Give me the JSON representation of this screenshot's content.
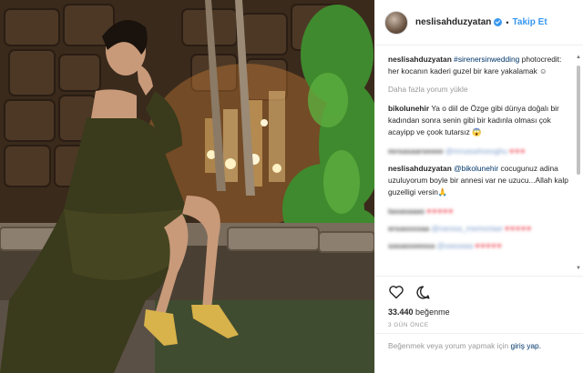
{
  "header": {
    "username": "neslisahduzyatan",
    "separator": "•",
    "follow_label": "Takip Et"
  },
  "caption": {
    "username": "neslisahduzyatan",
    "hashtag": "#sirenersinwedding",
    "text": "photocredit: her kocanın kaderi guzel bir kare yakalamak ☺"
  },
  "load_more_label": "Daha fazla yorum yükle",
  "comments": [
    {
      "username": "bikolunehir",
      "text": "Ya o diil de Özge gibi dünya doğalı bir kadından sonra senin gibi bir kadınla olması çok acayipp ve çook tutarsız 😱"
    },
    {
      "username": "neslisahduzyatan",
      "mention": "@bikolunehir",
      "text": "cocugunuz adina uzuluyorum boyle bir annesi var ne uzucu...Allah kalp guzelligi versin🙏"
    }
  ],
  "blurred_comments": [
    {
      "username": "mrsasaarseeee",
      "mention": "@mrsasahosoghu",
      "hearts": "♥♥♥"
    },
    {
      "username": "tasasaaas",
      "hearts": "♥♥♥♥♥"
    },
    {
      "username": "ersassssaa",
      "mention": "@narssa_memoriaar",
      "hearts": "♥♥♥♥♥"
    },
    {
      "username": "sasasseessa",
      "mention": "@sassaaa",
      "hearts": "♥♥♥♥♥"
    }
  ],
  "likes": {
    "count": "33.440",
    "label": "beğenme"
  },
  "time_label": "3 GÜN ÖNCE",
  "add_comment": {
    "prompt": "Beğenmek veya yorum yapmak için",
    "login_label": "giriş yap."
  },
  "scroll": {
    "up": "▲",
    "down": "▼"
  },
  "colors": {
    "link": "#003569",
    "accent": "#3897f0",
    "heart": "#ed4956"
  }
}
